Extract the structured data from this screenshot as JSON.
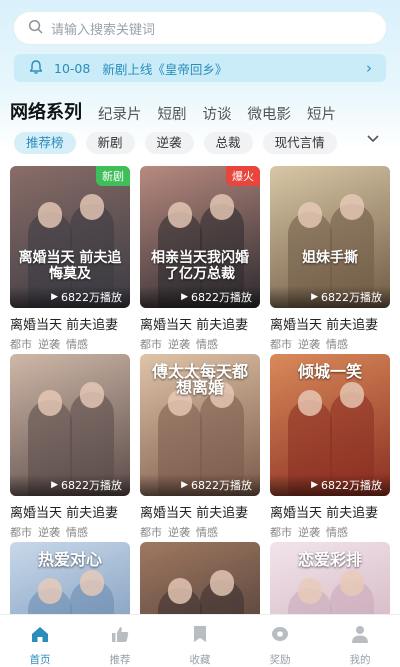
{
  "search": {
    "placeholder": "请输入搜索关键词",
    "icon": "search-icon"
  },
  "notice": {
    "date": "10-08",
    "text": "新剧上线《皇帝回乡》",
    "icon": "bell-icon"
  },
  "categories": [
    {
      "label": "网络系列",
      "active": true
    },
    {
      "label": "纪录片"
    },
    {
      "label": "短剧"
    },
    {
      "label": "访谈"
    },
    {
      "label": "微电影"
    },
    {
      "label": "短片"
    }
  ],
  "chips": [
    {
      "label": "推荐榜",
      "active": true
    },
    {
      "label": "新剧"
    },
    {
      "label": "逆袭"
    },
    {
      "label": "总裁"
    },
    {
      "label": "现代言情"
    }
  ],
  "cards": [
    {
      "title": "离婚当天 前夫追妻",
      "plays": "6822万播放",
      "tags": [
        "都市",
        "逆袭",
        "情感"
      ],
      "badge": "新剧",
      "badge_color": "#3fbf5a",
      "poster_text": "离婚当天 前夫追悔莫及",
      "text_pos": "mid",
      "colors": [
        "#3a3a42",
        "#8a6d68"
      ]
    },
    {
      "title": "离婚当天 前夫追妻",
      "plays": "6822万播放",
      "tags": [
        "都市",
        "逆袭",
        "情感"
      ],
      "badge": "爆火",
      "badge_color": "#e8453c",
      "poster_text": "相亲当天我闪婚了亿万总裁",
      "text_pos": "mid",
      "colors": [
        "#2c2a2e",
        "#b88a80"
      ]
    },
    {
      "title": "离婚当天 前夫追妻",
      "plays": "6822万播放",
      "tags": [
        "都市",
        "逆袭",
        "情感"
      ],
      "badge": "",
      "badge_color": "",
      "poster_text": "姐妹手撕",
      "text_pos": "mid",
      "colors": [
        "#6f5a45",
        "#d8c7a6"
      ]
    },
    {
      "title": "离婚当天 前夫追妻",
      "plays": "6822万播放",
      "tags": [
        "都市",
        "逆袭",
        "情感"
      ],
      "badge": "",
      "badge_color": "",
      "poster_text": "",
      "text_pos": "mid",
      "colors": [
        "#5a4a48",
        "#cfb8a8"
      ]
    },
    {
      "title": "离婚当天 前夫追妻",
      "plays": "6822万播放",
      "tags": [
        "都市",
        "逆袭",
        "情感"
      ],
      "badge": "",
      "badge_color": "",
      "poster_text": "傅太太每天都想离婚",
      "text_pos": "top",
      "colors": [
        "#7a5a4a",
        "#e0c4a8"
      ]
    },
    {
      "title": "离婚当天 前夫追妻",
      "plays": "6822万播放",
      "tags": [
        "都市",
        "逆袭",
        "情感"
      ],
      "badge": "",
      "badge_color": "",
      "poster_text": "倾城一笑",
      "text_pos": "top",
      "colors": [
        "#8a2e22",
        "#d98a5a"
      ]
    },
    {
      "title": "",
      "plays": "",
      "tags": [],
      "badge": "",
      "badge_color": "",
      "poster_text": "热爱对心",
      "text_pos": "top",
      "colors": [
        "#6a8ab0",
        "#c8d8ea"
      ]
    },
    {
      "title": "",
      "plays": "",
      "tags": [],
      "badge": "",
      "badge_color": "",
      "poster_text": "",
      "text_pos": "top",
      "colors": [
        "#3a3030",
        "#a07860"
      ]
    },
    {
      "title": "",
      "plays": "",
      "tags": [],
      "badge": "",
      "badge_color": "",
      "poster_text": "恋爱彩排",
      "text_pos": "top",
      "colors": [
        "#c9a8b8",
        "#f2e4ea"
      ]
    }
  ],
  "tabs": [
    {
      "label": "首页",
      "icon": "home-icon",
      "active": true
    },
    {
      "label": "推荐",
      "icon": "thumbs-up-icon"
    },
    {
      "label": "收藏",
      "icon": "bookmark-icon"
    },
    {
      "label": "奖励",
      "icon": "coin-icon"
    },
    {
      "label": "我的",
      "icon": "user-icon"
    }
  ],
  "colors": {
    "accent": "#2a8dbb",
    "notice_bg": "#c9ecf8",
    "chip_bg": "#f0f2f4"
  }
}
